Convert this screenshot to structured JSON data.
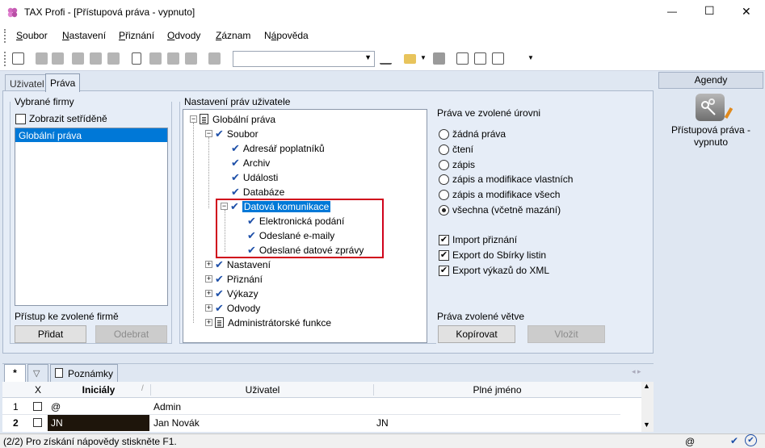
{
  "window": {
    "title": "TAX Profi - [Přístupová práva - vypnuto]",
    "minimize": "—",
    "maximize": "☐",
    "close": "✕"
  },
  "menu": [
    "Soubor",
    "Nastavení",
    "Přiznání",
    "Odvody",
    "Záznam",
    "Nápověda"
  ],
  "menu_underlined": [
    "S",
    "N",
    "P",
    "O",
    "Z",
    "á"
  ],
  "menu_rest": [
    "oubor",
    "astavení",
    "řiznání",
    "dvody",
    "áznam",
    "pověda"
  ],
  "menu_pre": [
    "",
    "",
    "",
    "",
    "",
    "N"
  ],
  "tabs": {
    "tab1": "Uživatel",
    "tab2": "Práva"
  },
  "firms": {
    "group_title": "Vybrané firmy",
    "sorted_label": "Zobrazit setříděně",
    "items": [
      "Globální práva"
    ],
    "access_label": "Přístup ke zvolené firmě",
    "add_button": "Přidat",
    "remove_button": "Odebrat"
  },
  "tree": {
    "group_title": "Nastavení práv uživatele",
    "nodes": [
      {
        "label": "Globální práva"
      },
      {
        "label": "Soubor"
      },
      {
        "label": "Adresář poplatníků"
      },
      {
        "label": "Archiv"
      },
      {
        "label": "Události"
      },
      {
        "label": "Databáze"
      },
      {
        "label": "Datová komunikace"
      },
      {
        "label": "Elektronická podání"
      },
      {
        "label": "Odeslané e-maily"
      },
      {
        "label": "Odeslané datové zprávy"
      },
      {
        "label": "Nastavení"
      },
      {
        "label": "Přiznání"
      },
      {
        "label": "Výkazy"
      },
      {
        "label": "Odvody"
      },
      {
        "label": "Administrátorské funkce"
      }
    ]
  },
  "rights": {
    "group_title": "Práva ve zvolené úrovni",
    "radios": [
      "žádná práva",
      "čtení",
      "zápis",
      "zápis a modifikace vlastních",
      "zápis a modifikace všech",
      "všechna (včetně mazání)"
    ],
    "selected_radio": 5,
    "checks": [
      "Import přiznání",
      "Export do Sbírky listin",
      "Export výkazů do XML"
    ],
    "branch_label": "Práva zvolené větve",
    "copy_button": "Kopírovat",
    "paste_button": "Vložit"
  },
  "agendy": {
    "header": "Agendy",
    "item_label": "Přístupová práva - vypnuto"
  },
  "bottom_tabs": {
    "star": "*",
    "notes": "Poznámky"
  },
  "grid": {
    "columns": [
      "",
      "X",
      "Iniciály",
      "Uživatel",
      "Plné jméno"
    ],
    "sort_arrow": "/",
    "rows": [
      {
        "num": "1",
        "initials": "@",
        "user": "Admin",
        "fullname": ""
      },
      {
        "num": "2",
        "initials": "JN",
        "user": "Jan Novák",
        "fullname": "JN"
      }
    ]
  },
  "status": {
    "text": "(2/2)  Pro získání nápovědy stiskněte F1.",
    "at": "@"
  },
  "colors": {
    "accent": "#0078d7",
    "selection": "#0078d7",
    "highlight_box": "#d0021b",
    "check_blue": "#1d4fa8"
  }
}
